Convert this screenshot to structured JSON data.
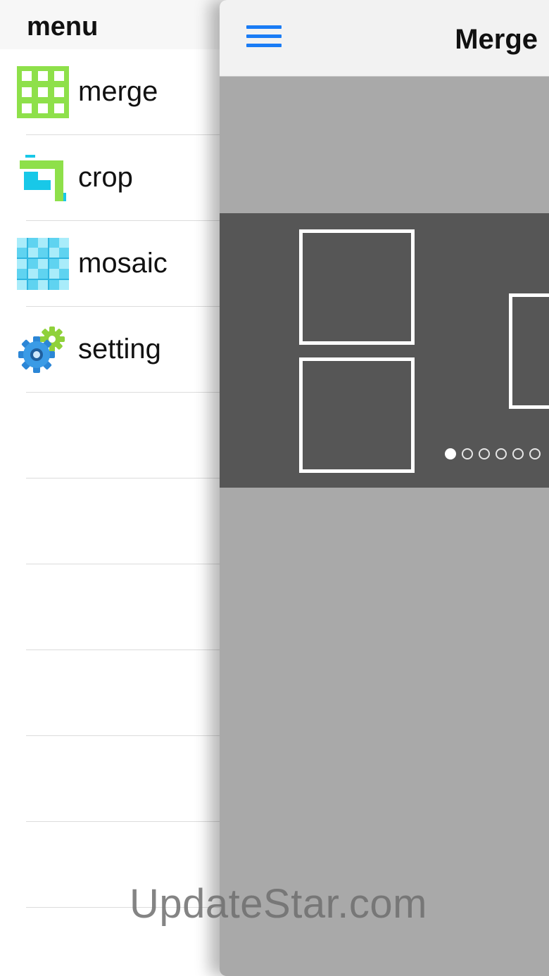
{
  "side_menu": {
    "title": "menu",
    "items": [
      {
        "label": "merge",
        "icon": "grid-icon"
      },
      {
        "label": "crop",
        "icon": "crop-icon"
      },
      {
        "label": "mosaic",
        "icon": "mosaic-icon"
      },
      {
        "label": "setting",
        "icon": "gear-icon"
      }
    ]
  },
  "navbar": {
    "title": "Merge",
    "menu_icon": "hamburger-icon"
  },
  "carousel": {
    "page_count": 6,
    "current_page": 1
  },
  "watermark": "UpdateStar.com",
  "colors": {
    "accent_blue": "#1a7cf5",
    "merge_icon_green": "#8ee04a",
    "crop_icon_cyan": "#18c8e8",
    "mosaic_icon_cyan": "#5fd3f0",
    "panel_gray": "#a9a9a9",
    "carousel_dark": "#565656"
  }
}
